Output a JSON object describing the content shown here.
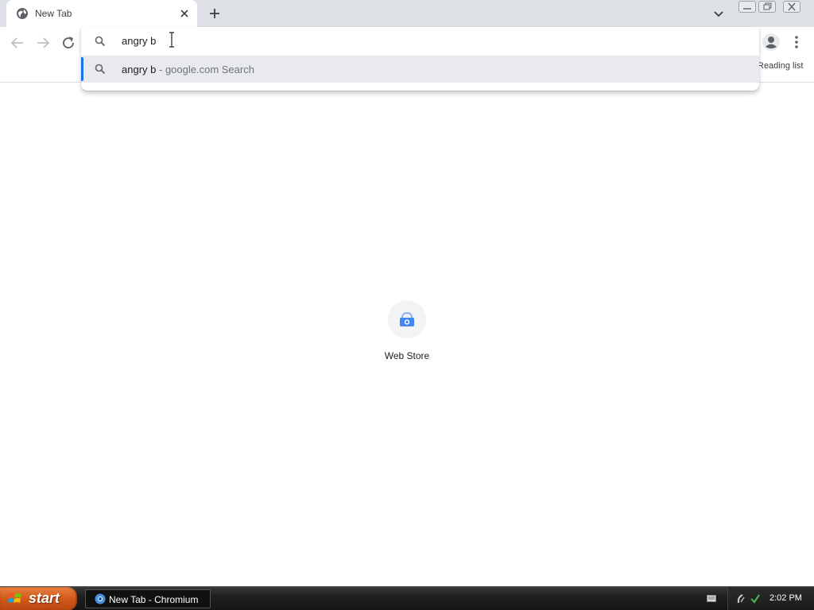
{
  "tab": {
    "title": "New Tab"
  },
  "toolbar": {
    "reading_list": "Reading list"
  },
  "omnibox": {
    "input_text": "angry b",
    "suggestion": {
      "query": "angry b",
      "separator": " - ",
      "description": "google.com Search"
    }
  },
  "ntp": {
    "shortcuts": [
      {
        "label": "Web Store",
        "icon": "web-store-icon"
      }
    ]
  },
  "taskbar": {
    "start_label": "start",
    "task_label": "New Tab - Chromium",
    "clock": "2:02 PM"
  },
  "colors": {
    "tabstrip": "#dee1e6",
    "accent": "#1a73e8",
    "suggestion_highlight": "#e8eaed",
    "start_button": "#d2591a"
  }
}
